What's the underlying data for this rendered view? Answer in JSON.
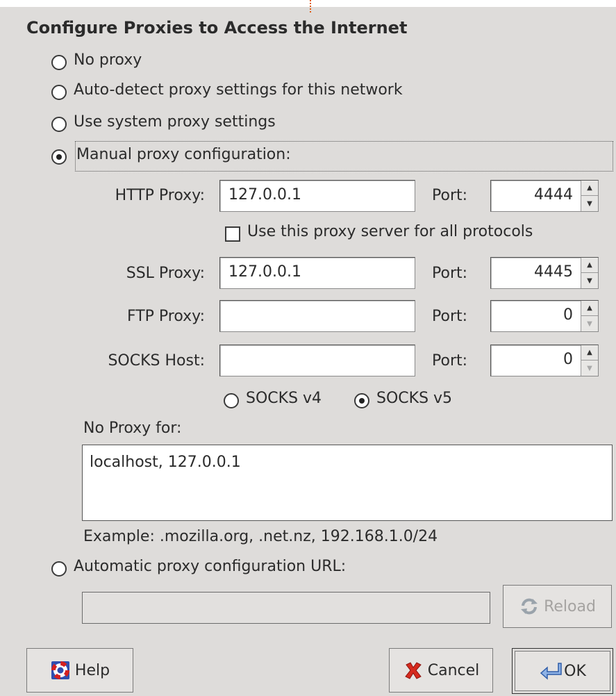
{
  "dialog": {
    "title": "Configure Proxies to Access the Internet"
  },
  "options": {
    "no_proxy": "No proxy",
    "auto_detect": "Auto-detect proxy settings for this network",
    "system": "Use system proxy settings",
    "manual": "Manual proxy configuration:",
    "auto_url": "Automatic proxy configuration URL:"
  },
  "manual": {
    "http_label": "HTTP Proxy:",
    "http_value": "127.0.0.1",
    "http_port_label": "Port:",
    "http_port": "4444",
    "use_all_label": "Use this proxy server for all protocols",
    "ssl_label": "SSL Proxy:",
    "ssl_value": "127.0.0.1",
    "ssl_port_label": "Port:",
    "ssl_port": "4445",
    "ftp_label": "FTP Proxy:",
    "ftp_value": "",
    "ftp_port_label": "Port:",
    "ftp_port": "0",
    "socks_label": "SOCKS Host:",
    "socks_value": "",
    "socks_port_label": "Port:",
    "socks_port": "0",
    "socks_v4": "SOCKS v4",
    "socks_v5": "SOCKS v5",
    "no_proxy_label": "No Proxy for:",
    "no_proxy_value": "localhost, 127.0.0.1",
    "example": "Example: .mozilla.org, .net.nz, 192.168.1.0/24"
  },
  "auto_url": {
    "value": "",
    "reload_label": "Reload"
  },
  "buttons": {
    "help": "Help",
    "cancel": "Cancel",
    "ok": "OK"
  },
  "selected": {
    "mode": "manual",
    "socks_version": "v5",
    "use_all_protocols": false
  },
  "icons": {
    "help": "lifebuoy-icon",
    "cancel": "red-x-icon",
    "ok": "enter-arrow-icon",
    "reload": "reload-icon"
  }
}
